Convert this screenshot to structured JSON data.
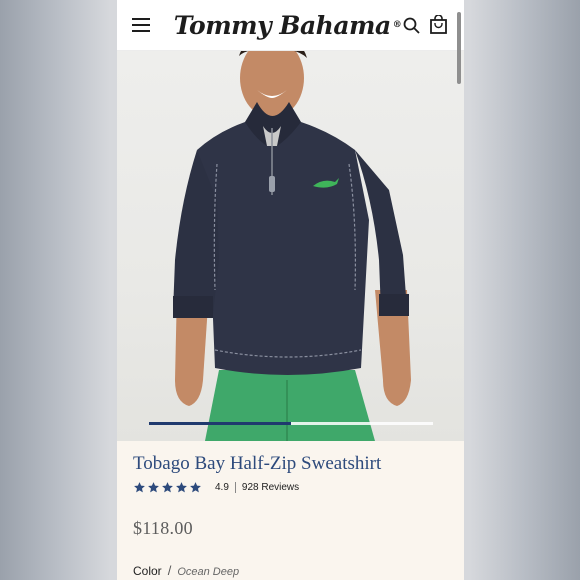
{
  "header": {
    "brand": "Tommy Bahama",
    "brand_mark": "®",
    "icons": [
      "menu-icon",
      "search-icon",
      "shopping-bag-icon"
    ]
  },
  "gallery": {
    "image": "product-photo",
    "carousel_progress": 0.5
  },
  "product": {
    "title": "Tobago Bay Half-Zip Sweatshirt",
    "stars": 5,
    "rating": "4.9",
    "reviews": "928 Reviews",
    "price": "$118.00",
    "color_label": "Color",
    "color_separator": "/",
    "color_value": "Ocean Deep"
  },
  "colors": {
    "accent_blue": "#2d4a7c",
    "star_blue": "#2d4a7c",
    "info_background": "#faf5ee",
    "sweatshirt_navy": "#2f3447",
    "shorts_green": "#3fa86a",
    "logo_green": "#3fb55a"
  }
}
